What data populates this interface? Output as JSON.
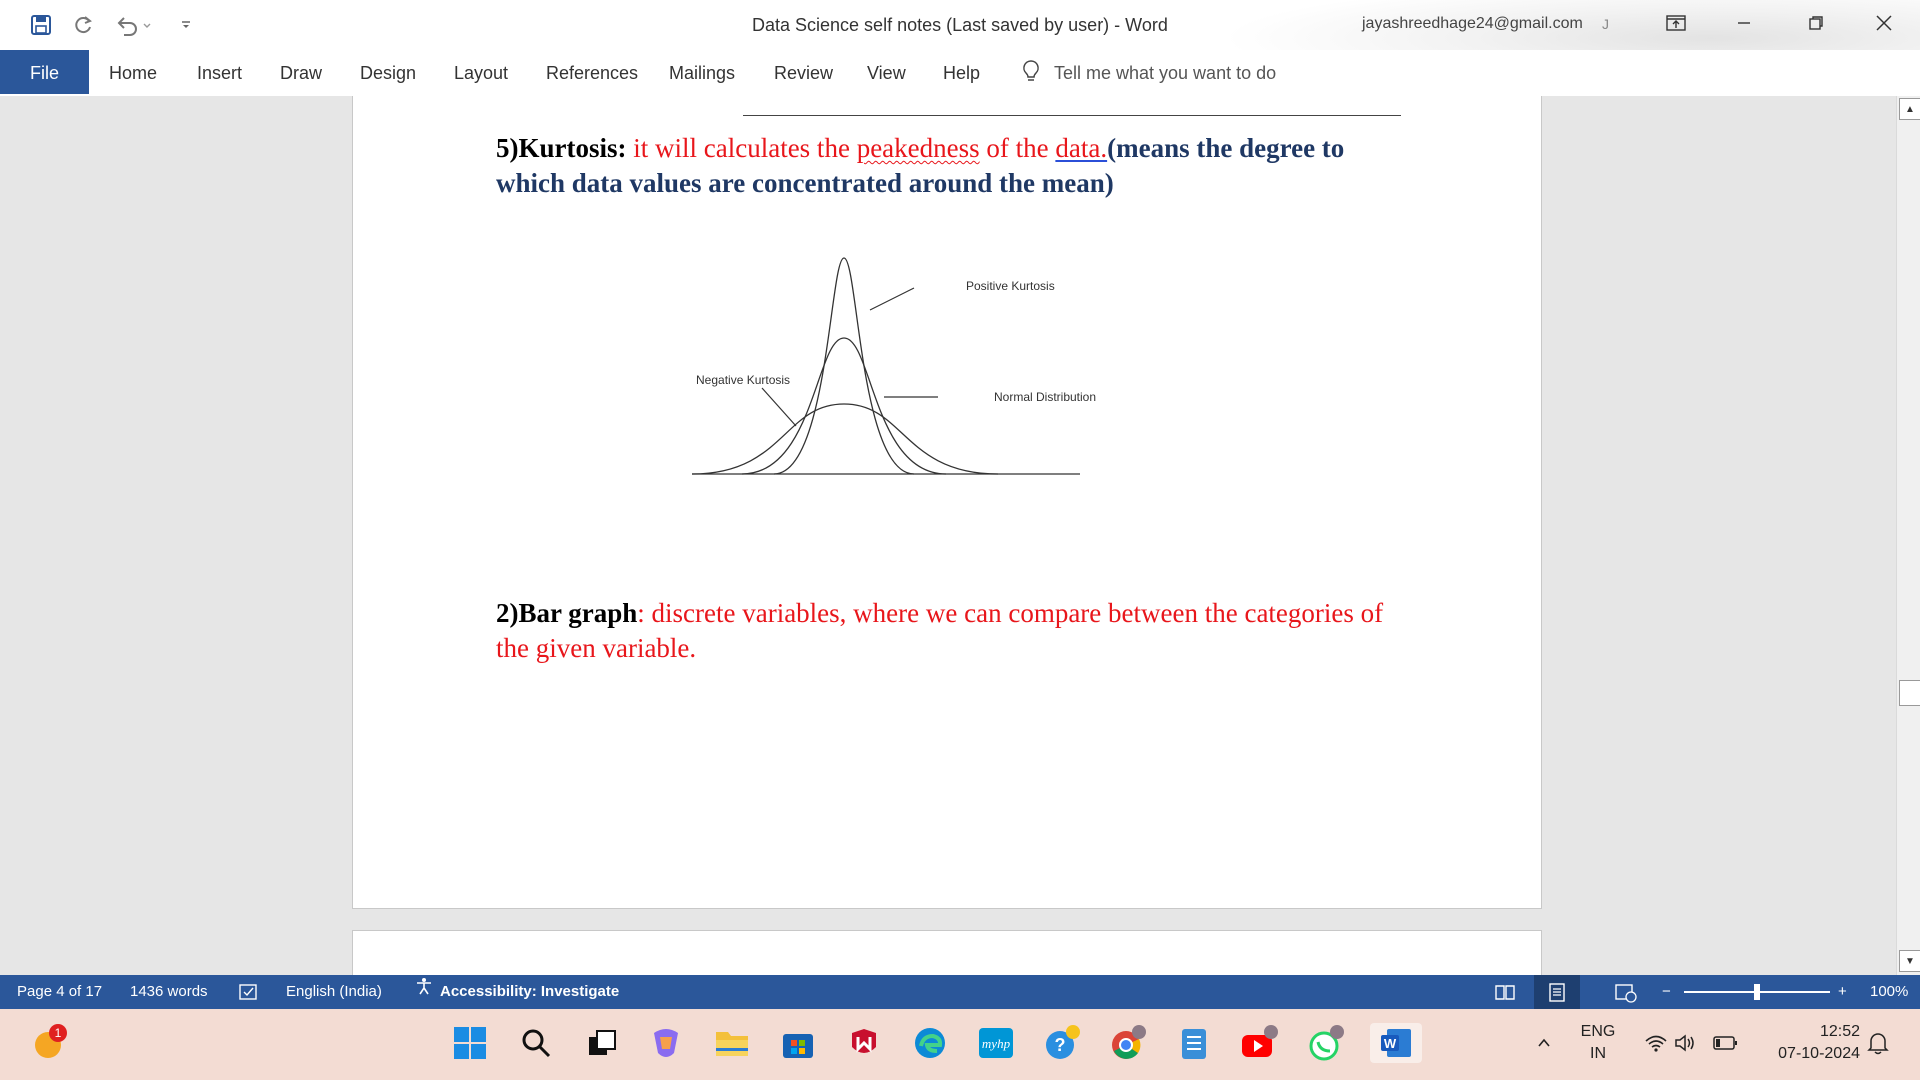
{
  "window": {
    "title": "Data Science self notes (Last saved by user)  -  Word",
    "account_email": "jayashreedhage24@gmail.com",
    "account_initial": "J"
  },
  "ribbon": {
    "tabs": [
      "File",
      "Home",
      "Insert",
      "Draw",
      "Design",
      "Layout",
      "References",
      "Mailings",
      "Review",
      "View",
      "Help"
    ],
    "tell_me": "Tell me what you want to do"
  },
  "document": {
    "kurtosis": {
      "heading": "5)Kurtosis:",
      "text1": " it will calculates the ",
      "text2": "peakedness",
      "text3": " of the ",
      "text4": "data.",
      "text5": "(means the degree to which data values are concentrated around the mean)"
    },
    "figure": {
      "label_positive": "Positive Kurtosis",
      "label_negative": "Negative Kurtosis",
      "label_normal": "Normal Distribution"
    },
    "bar_graph": {
      "heading": "2)Bar graph",
      "text": ":  discrete variables, where we can compare between the categories of the given variable."
    }
  },
  "statusbar": {
    "page": "Page 4 of 17",
    "words": "1436 words",
    "language": "English (India)",
    "accessibility": "Accessibility: Investigate",
    "zoom": "100%"
  },
  "taskbar": {
    "weather_badge": "1",
    "lang_line1": "ENG",
    "lang_line2": "IN",
    "time": "12:52",
    "date": "07-10-2024",
    "myhp": "myhp"
  },
  "colors": {
    "word_blue": "#2b579a",
    "red_text": "#e8161b",
    "navy_text": "#1f3864",
    "taskbar_bg": "#f3dcd3"
  }
}
